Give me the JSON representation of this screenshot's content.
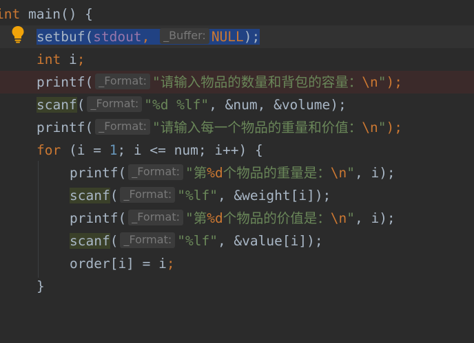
{
  "colors": {
    "background": "#2b2b2b",
    "keyword": "#cc7832",
    "string": "#6a8759",
    "number": "#6897bb",
    "function_highlight": "#3a4029",
    "selection": "#214283",
    "hint_bg": "#3b3b3b",
    "bulb": "#f0a30a"
  },
  "icons": {
    "intention": "lightbulb-icon"
  },
  "code": {
    "l1": {
      "type": "int",
      "name": "main",
      "rest": "() {"
    },
    "l2": {
      "fn": "setbuf",
      "open": "(",
      "arg1": "stdout",
      "comma": ", ",
      "hint": "_Buffer:",
      "arg2": "NULL",
      "close": ");"
    },
    "l3": {
      "type": "int",
      "rest": " i",
      "semi": ";"
    },
    "l4": {
      "fn": "printf",
      "open": "(",
      "hint": "_Format:",
      "str": "\"请输入物品的数量和背包的容量：",
      "esc": "\\n",
      "strend": "\"",
      "close": ");"
    },
    "l5": {
      "fn": "scanf",
      "open": "(",
      "hint": "_Format:",
      "str": "\"%d %lf\"",
      "rest": ", &num, &volume);"
    },
    "l6": {
      "fn": "printf",
      "open": "(",
      "hint": "_Format:",
      "str": "\"请输入每一个物品的重量和价值：",
      "esc": "\\n",
      "strend": "\"",
      "close": ");"
    },
    "l7": {
      "kw": "for",
      "a": " (i = ",
      "n1": "1",
      "b": "; i <= num; i++) {"
    },
    "l8": {
      "fn": "printf",
      "open": "(",
      "hint": "_Format:",
      "str1": "\"第",
      "fmt": "%d",
      "str2": "个物品的重量是：",
      "esc": "\\n",
      "strend": "\"",
      "rest": ", i);"
    },
    "l9": {
      "fn": "scanf",
      "open": "(",
      "hint": "_Format:",
      "str": "\"%lf\"",
      "rest": ", &weight[i]);"
    },
    "l10": {
      "fn": "printf",
      "open": "(",
      "hint": "_Format:",
      "str1": "\"第",
      "fmt": "%d",
      "str2": "个物品的价值是：",
      "esc": "\\n",
      "strend": "\"",
      "rest": ", i);"
    },
    "l11": {
      "fn": "scanf",
      "open": "(",
      "hint": "_Format:",
      "str": "\"%lf\"",
      "rest": ", &value[i]);"
    },
    "l12": {
      "rest": "order[i] = i",
      "semi": ";"
    },
    "l13": {
      "rest": "}"
    }
  }
}
